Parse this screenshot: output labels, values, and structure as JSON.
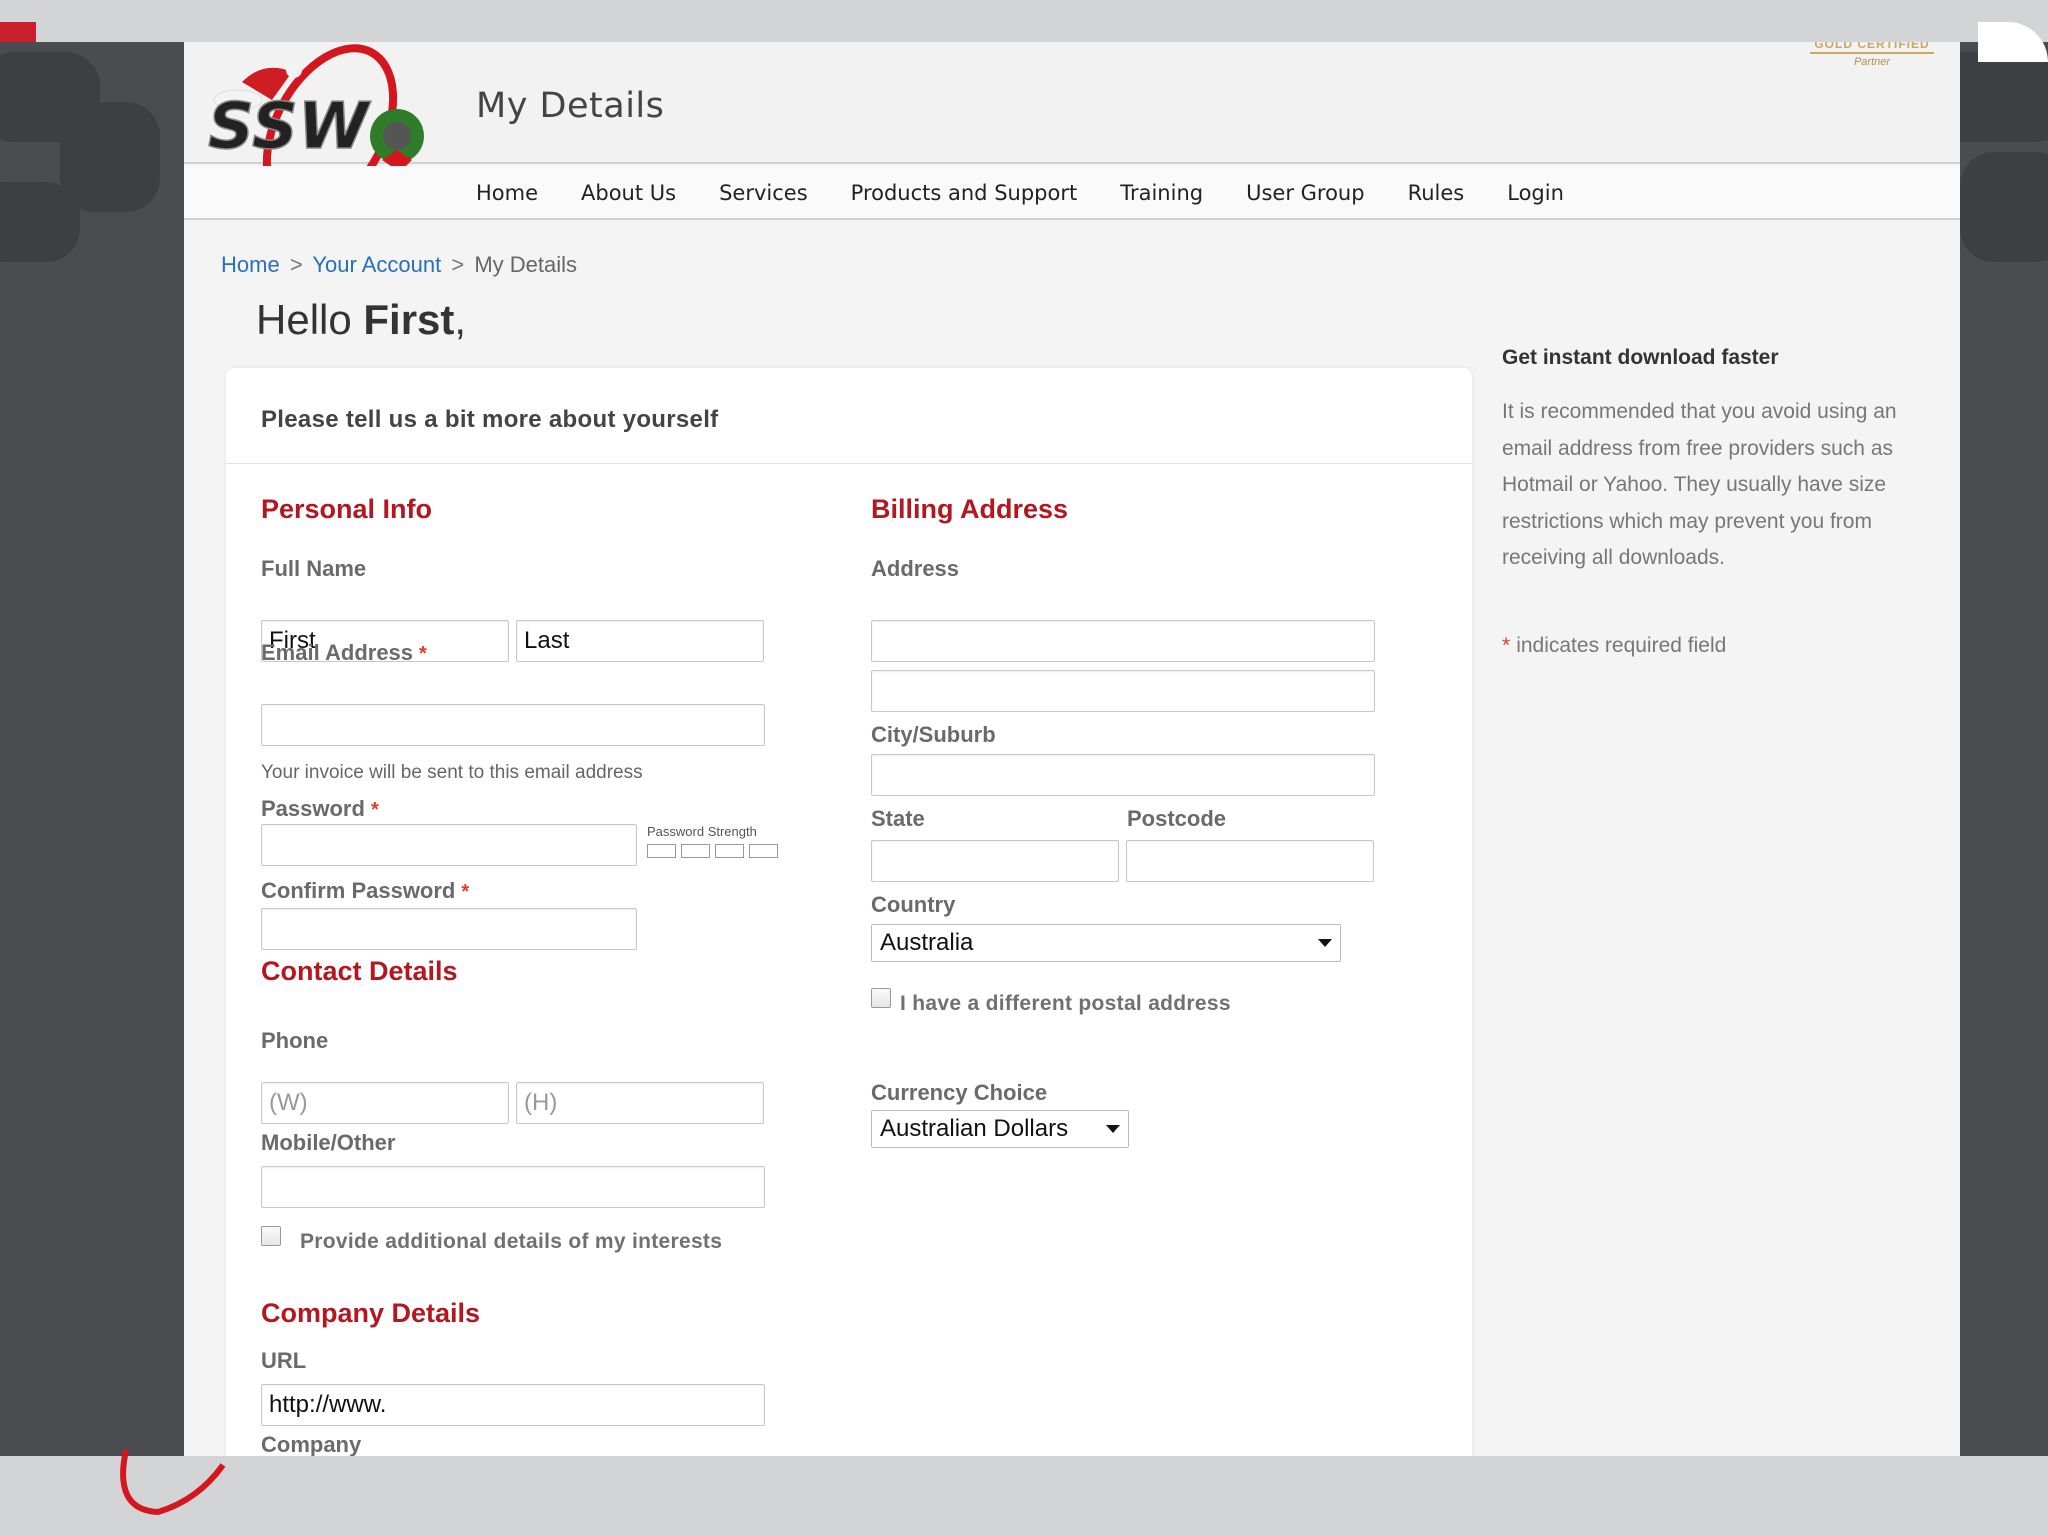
{
  "header": {
    "title": "My Details",
    "logo_text": "SSW",
    "certification": {
      "line1": "GOLD CERTIFIED",
      "line2": "Partner"
    }
  },
  "nav": {
    "items": [
      {
        "label": "Home"
      },
      {
        "label": "About Us"
      },
      {
        "label": "Services"
      },
      {
        "label": "Products and Support"
      },
      {
        "label": "Training"
      },
      {
        "label": "User Group"
      },
      {
        "label": "Rules"
      },
      {
        "label": "Login"
      }
    ]
  },
  "breadcrumb": {
    "home": "Home",
    "account": "Your Account",
    "current": "My Details",
    "separator": ">"
  },
  "greeting": {
    "prefix": "Hello",
    "name": "First",
    "suffix": ","
  },
  "form": {
    "title": "Please tell us a bit more about yourself",
    "personal": {
      "heading": "Personal Info",
      "full_name_label": "Full Name",
      "first_value": "First",
      "last_value": "Last",
      "email_label": "Email Address",
      "email_value": "",
      "email_hint": "Your invoice will be sent to this email address",
      "password_label": "Password",
      "password_strength_label": "Password Strength",
      "confirm_password_label": "Confirm Password",
      "required_mark": "*"
    },
    "contact": {
      "heading": "Contact Details",
      "phone_label": "Phone",
      "phone_work_placeholder": "(W)",
      "phone_home_placeholder": "(H)",
      "mobile_label": "Mobile/Other",
      "interests_label": "Provide additional details of my interests",
      "interests_checked": false
    },
    "company": {
      "heading": "Company Details",
      "url_label": "URL",
      "url_value": "http://www.",
      "company_label": "Company"
    },
    "billing": {
      "heading": "Billing Address",
      "address_label": "Address",
      "city_label": "City/Suburb",
      "state_label": "State",
      "postcode_label": "Postcode",
      "country_label": "Country",
      "country_value": "Australia",
      "postal_label": "I have a different postal address",
      "postal_checked": false,
      "currency_label": "Currency Choice",
      "currency_value": "Australian Dollars"
    }
  },
  "sidebar": {
    "title": "Get instant download faster",
    "text": "It is recommended that you avoid using an email address from free providers such as Hotmail or Yahoo. They usually have size restrictions which may prevent you from receiving all downloads.",
    "required_note": "indicates required field",
    "required_mark": "*"
  },
  "colors": {
    "accent_red": "#b3171f",
    "link_blue": "#2a6fb8",
    "required_star": "#e23a2a",
    "background_dark": "#4b4c4f"
  }
}
